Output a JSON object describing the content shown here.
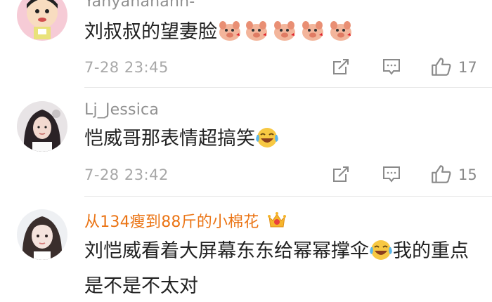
{
  "comments": [
    {
      "username": "Yanyananann-",
      "text": "刘叔叔的望妻脸",
      "emoji": [
        "pig-face-emoji",
        "pig-face-emoji",
        "pig-face-emoji",
        "pig-face-emoji",
        "pig-face-emoji"
      ],
      "time": "7-28 23:45",
      "likes": "17"
    },
    {
      "username": "Lj_Jessica",
      "text": "恺威哥那表情超搞笑",
      "emoji": [
        "laugh-cry-emoji"
      ],
      "time": "7-28 23:42",
      "likes": "15"
    },
    {
      "username": "从134瘦到88斤的小棉花",
      "badge": "crown-badge-icon",
      "text_part1": "刘恺威看着大屏幕东东给幂幂撑伞",
      "emoji": [
        "laugh-cry-emoji"
      ],
      "text_part2": "我的重点是不是不太对"
    }
  ],
  "colors": {
    "username": "#8f8f8f",
    "vip_username": "#eb7516",
    "text": "#222222",
    "meta": "#a8a8a8"
  }
}
